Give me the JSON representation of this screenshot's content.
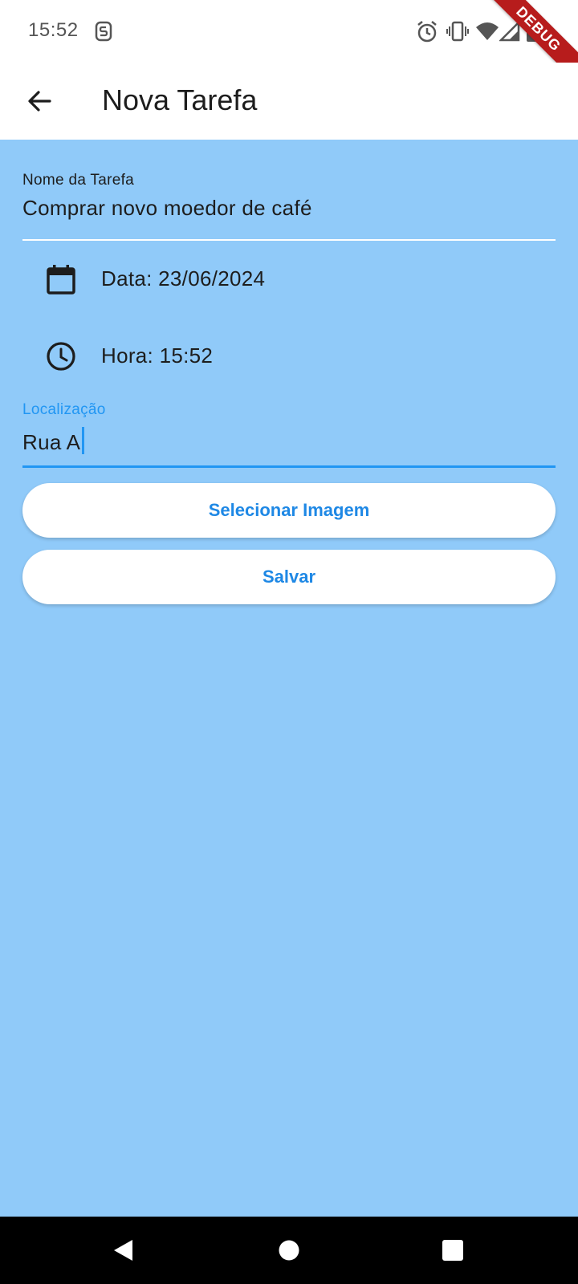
{
  "status_bar": {
    "time": "15:52",
    "icons": [
      "s-notification-icon",
      "alarm-icon",
      "vibrate-icon",
      "wifi-icon",
      "signal-icon",
      "battery-icon"
    ]
  },
  "debug_banner": "DEBUG",
  "app_bar": {
    "title": "Nova Tarefa",
    "back_icon": "arrow-back-icon"
  },
  "form": {
    "task_name": {
      "label": "Nome da Tarefa",
      "value": "Comprar novo moedor de café"
    },
    "date": {
      "icon": "calendar-icon",
      "text": "Data: 23/06/2024"
    },
    "time": {
      "icon": "clock-icon",
      "text": "Hora: 15:52"
    },
    "location": {
      "label": "Localização",
      "value": "Rua A"
    },
    "select_image_label": "Selecionar Imagem",
    "save_label": "Salvar"
  },
  "colors": {
    "background": "#90CAF9",
    "accent": "#2196F3",
    "button_text": "#1E88E5",
    "debug_banner": "#B71C1C"
  },
  "nav_bar": {
    "icons": [
      "back-triangle-icon",
      "home-circle-icon",
      "recents-square-icon"
    ]
  }
}
